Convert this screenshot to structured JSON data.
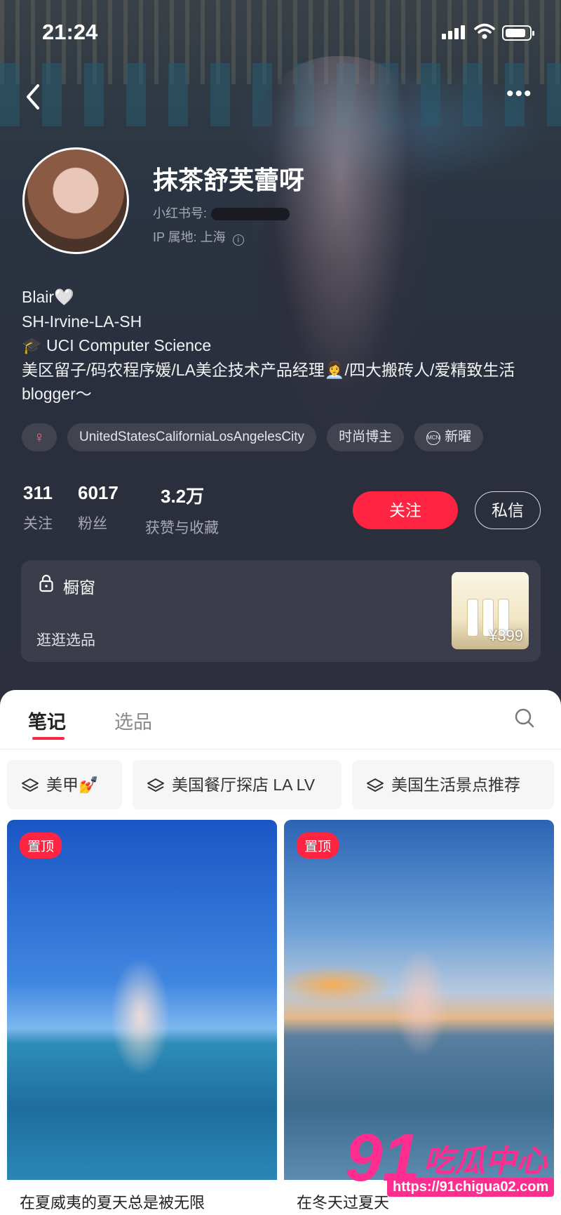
{
  "status_bar": {
    "time": "21:24"
  },
  "profile": {
    "nickname": "抹茶舒芙蕾呀",
    "red_id_label": "小红书号:",
    "ip_label": "IP 属地: 上海",
    "bio_lines": [
      "Blair🤍",
      "SH-Irvine-LA-SH",
      "🎓 UCI Computer Science",
      "美区留子/码农程序媛/LA美企技术产品经理👩‍💼/四大搬砖人/爱精致生活blogger～"
    ],
    "tags": {
      "gender": "♀",
      "location": "UnitedStatesCaliforniaLosAngelesCity",
      "category": "时尚博主",
      "mcn_icon": "MCN",
      "mcn": "新曜"
    },
    "stats": [
      {
        "value": "311",
        "label": "关注"
      },
      {
        "value": "6017",
        "label": "粉丝"
      },
      {
        "value": "3.2万",
        "label": "获赞与收藏"
      }
    ],
    "follow_label": "关注",
    "message_label": "私信"
  },
  "shop": {
    "title": "橱窗",
    "subtitle": "逛逛选品",
    "price": "¥399"
  },
  "tabs": {
    "notes": "笔记",
    "products": "选品"
  },
  "collections": [
    "美甲💅",
    "美国餐厅探店 LA LV",
    "美国生活景点推荐"
  ],
  "notes": [
    {
      "pin": "置顶",
      "caption": "在夏威夷的夏天总是被无限"
    },
    {
      "pin": "置顶",
      "caption": "在冬天过夏天"
    }
  ],
  "watermark": {
    "number": "91",
    "text": "吃瓜中心",
    "url": "https://91chigua02.com"
  },
  "colors": {
    "accent": "#ff2442",
    "background": "#2d2f3c",
    "watermark": "#ff2d8f"
  }
}
